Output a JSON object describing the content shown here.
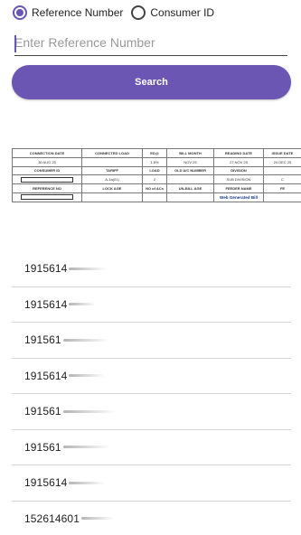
{
  "radio": {
    "options": [
      {
        "label": "Reference Number",
        "selected": true
      },
      {
        "label": "Consumer ID",
        "selected": false
      }
    ]
  },
  "search": {
    "placeholder": "Enter Reference Number",
    "value": "",
    "button_label": "Search"
  },
  "bill_preview": {
    "row1": [
      "CONNECTION DATE",
      "CONNECTED LOAD",
      "ED@",
      "BILL MONTH",
      "READING DATE",
      "ISSUE DATE"
    ],
    "row2": [
      "30 AUG 25",
      "",
      "1.5%",
      "NOV 25",
      "27 NOV 25",
      "24 DEC 25"
    ],
    "row3": [
      "CONSUMER ID",
      "TARIFF",
      "LOAD",
      "OLD A/C NUMBER",
      "DIVISION",
      ""
    ],
    "row4": [
      "",
      "A-1a(01)",
      "2",
      "",
      "SUB DIVISION",
      "C"
    ],
    "row5": [
      "REFERENCE NO",
      "LOCK AGE",
      "NO of ACs",
      "UN-BILL AGE",
      "FEEDER NAME",
      "FE"
    ],
    "row6": [
      "",
      "",
      "",
      "",
      "Web Generated Bill",
      ""
    ]
  },
  "results": [
    "1915614",
    "1915614",
    "191561",
    "1915614",
    "191561",
    "191561",
    "1915614",
    "152614601"
  ],
  "colors": {
    "accent": "#6b57b3",
    "link_blue": "#1a3c8e"
  }
}
